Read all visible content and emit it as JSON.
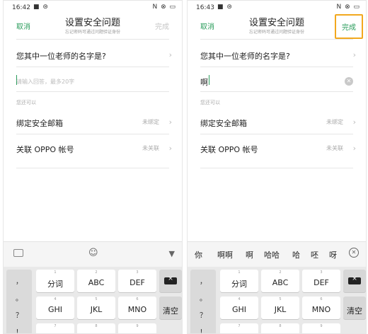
{
  "left": {
    "status": {
      "time": "16:42",
      "left_icons": "■ ⊜",
      "right_icons": "N ⊗ ▭"
    },
    "header": {
      "cancel": "取消",
      "title": "设置安全问题",
      "subtitle": "忘记密码可通过问题验证身份",
      "done": "完成"
    },
    "question": "您其中一位老师的名字是?",
    "answer_placeholder": "请输入回答，最多20字",
    "hint": "您还可以",
    "rows": [
      {
        "label": "绑定安全邮箱",
        "value": "未绑定"
      },
      {
        "label": "关联 OPPO 帐号",
        "value": "未关联"
      }
    ],
    "keyboard_toolbar": {
      "emoji_icon": "emoji-icon",
      "collapse_icon": "chevron-down-icon"
    }
  },
  "right": {
    "status": {
      "time": "16:43",
      "left_icons": "■ ⊜",
      "right_icons": "N ⊗ ▭"
    },
    "header": {
      "cancel": "取消",
      "title": "设置安全问题",
      "subtitle": "忘记密码可通过问题验证身份",
      "done": "完成"
    },
    "question": "您其中一位老师的名字是?",
    "answer_value": "啊",
    "hint": "您还可以",
    "rows": [
      {
        "label": "绑定安全邮箱",
        "value": "未绑定"
      },
      {
        "label": "关联 OPPO 帐号",
        "value": "未关联"
      }
    ],
    "candidates": [
      "你",
      "啊啊",
      "啊",
      "哈哈",
      "哈",
      "呸",
      "呀"
    ]
  },
  "keyboard": {
    "punct": [
      "，",
      "。",
      "？",
      "！"
    ],
    "row1": [
      {
        "num": "1",
        "label": "分词"
      },
      {
        "num": "2",
        "label": "ABC"
      },
      {
        "num": "3",
        "label": "DEF"
      }
    ],
    "row2": [
      {
        "num": "4",
        "label": "GHI"
      },
      {
        "num": "5",
        "label": "JKL"
      },
      {
        "num": "6",
        "label": "MNO"
      }
    ],
    "clear_label": "清空",
    "row3_subs": [
      "7",
      "8",
      "9"
    ]
  },
  "colors": {
    "accent": "#2a9c5b",
    "highlight": "#f2a81e"
  }
}
